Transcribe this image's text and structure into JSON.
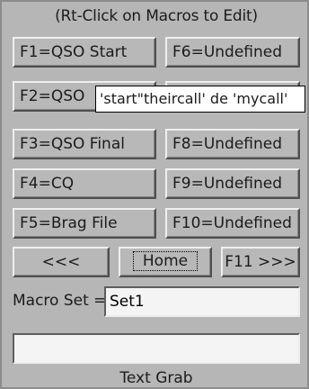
{
  "hint": "(Rt-Click on Macros to Edit)",
  "macros": {
    "f1": "F1=QSO Start",
    "f2": "F2=QSO",
    "f3": "F3=QSO Final",
    "f4": "F4=CQ",
    "f5": "F5=Brag File",
    "f6": "F6=Undefined",
    "f8": "F8=Undefined",
    "f9": "F9=Undefined",
    "f10": "F10=Undefined"
  },
  "tooltip": "'start\"theircall' de 'mycall'",
  "nav": {
    "prev": "<<<",
    "home": "Home",
    "next": "F11 >>>"
  },
  "macro_set": {
    "label": "Macro Set =",
    "value": "Set1"
  },
  "text_grab": {
    "value": "",
    "label": "Text Grab"
  }
}
